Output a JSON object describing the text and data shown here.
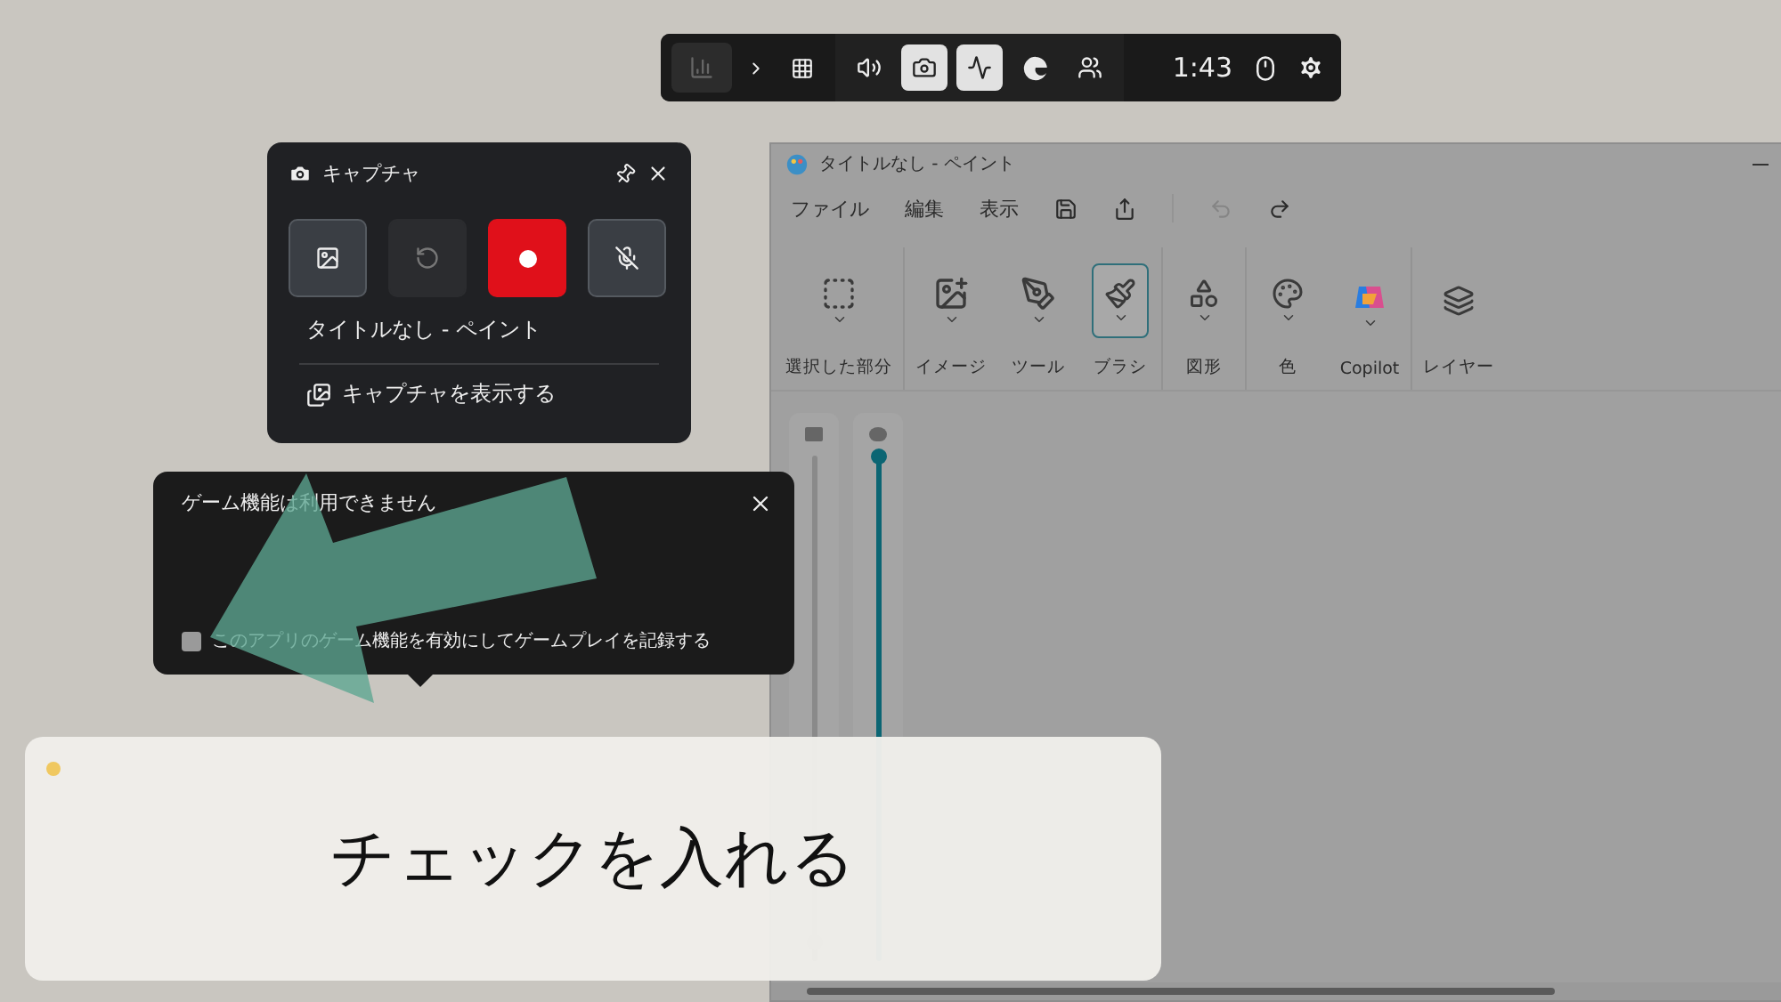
{
  "game_bar": {
    "widgets": [
      {
        "kind": "chart",
        "selected": false
      },
      {
        "kind": "more",
        "selected": false
      },
      {
        "kind": "grid",
        "selected": false
      },
      {
        "kind": "audio",
        "selected": false
      },
      {
        "kind": "capture",
        "selected": true
      },
      {
        "kind": "performance",
        "selected": true
      },
      {
        "kind": "browser",
        "selected": false
      },
      {
        "kind": "social",
        "selected": false
      }
    ],
    "time": "1:43"
  },
  "capture_panel": {
    "title": "キャプチャ",
    "buttons": [
      {
        "kind": "screenshot",
        "disabled": false
      },
      {
        "kind": "last30",
        "disabled": true
      },
      {
        "kind": "record",
        "disabled": false
      },
      {
        "kind": "mic",
        "disabled": false
      }
    ],
    "app_name": "タイトルなし - ペイント",
    "show_link": "キャプチャを表示する"
  },
  "notice": {
    "title": "ゲーム機能は利用できません",
    "checkbox": {
      "label": "このアプリのゲーム機能を有効にしてゲームプレイを記録する",
      "checked": false
    }
  },
  "paint": {
    "title": "タイトルなし - ペイント",
    "menu": [
      "ファイル",
      "編集",
      "表示"
    ],
    "tools": [
      {
        "kind": "select",
        "label": "選択した部分",
        "selected": false
      },
      {
        "kind": "image",
        "label": "イメージ",
        "selected": false
      },
      {
        "kind": "tools",
        "label": "ツール",
        "selected": false
      },
      {
        "kind": "brush",
        "label": "ブラシ",
        "selected": true
      },
      {
        "kind": "shapes",
        "label": "図形",
        "selected": false
      },
      {
        "kind": "color",
        "label": "色",
        "selected": false
      },
      {
        "kind": "copilot",
        "label": "Copilot",
        "selected": false
      },
      {
        "kind": "layers",
        "label": "レイヤー",
        "selected": false
      }
    ],
    "sliders": [
      {
        "kind": "size",
        "level": 0.04
      },
      {
        "kind": "opacity",
        "level": 1
      }
    ]
  },
  "caption": {
    "text": "チェックを入れる"
  }
}
